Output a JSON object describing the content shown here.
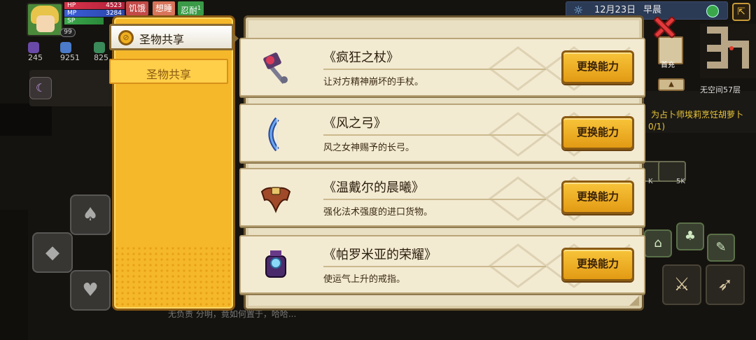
{
  "hud": {
    "hp_label": "HP",
    "hp_value": "4523",
    "mp_label": "MP",
    "mp_value": "3284",
    "sp_label": "SP",
    "level": "99",
    "status": {
      "hunger": "饥饿",
      "sleep": "想睡",
      "endure": "忍耐",
      "endure_count": "1"
    },
    "resources": [
      {
        "icon": "heart-down-icon",
        "value": "245"
      },
      {
        "icon": "gem-icon",
        "value": "9251"
      },
      {
        "icon": "coin-icon",
        "value": "825"
      }
    ],
    "date": "12月23日",
    "time_of_day": "早晨",
    "shop_label": "首充",
    "space_text": "无空间57层",
    "quest_text": "为占卜师埃莉烹饪胡萝卜",
    "quest_count": "0/1)",
    "coin_labels": [
      "K",
      "5K"
    ],
    "bottom_text": "无负责   分明，竟如何置于，哈哈..."
  },
  "dialog": {
    "tabs": [
      {
        "label": "圣物共享",
        "icon": "relic-icon",
        "active": true
      },
      {
        "label": "圣物共享",
        "active": false
      }
    ],
    "swap_label": "更换能力",
    "items": [
      {
        "name": "《疯狂之杖》",
        "desc": "让对方精神崩坏的手杖。",
        "icon": "staff-icon"
      },
      {
        "name": "《风之弓》",
        "desc": "风之女神赐予的长弓。",
        "icon": "bow-icon"
      },
      {
        "name": "《温戴尔的晨曦》",
        "desc": "强化法术强度的进口货物。",
        "icon": "armor-icon"
      },
      {
        "name": "《帕罗米亚的荣耀》",
        "desc": "使运气上升的戒指。",
        "icon": "ring-icon"
      }
    ]
  },
  "colors": {
    "panel_gold": "#f5b82a",
    "card_bg": "#f3ead2",
    "button_gold": "#e29a14",
    "close_red": "#e2393a"
  }
}
